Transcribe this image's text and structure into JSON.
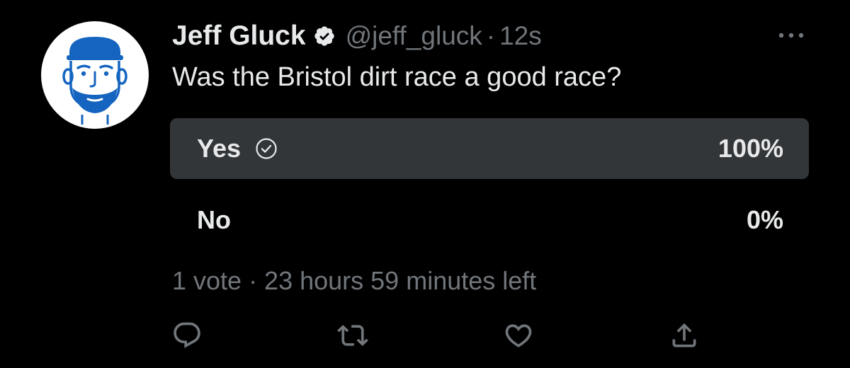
{
  "tweet": {
    "author": {
      "display_name": "Jeff Gluck",
      "handle": "@jeff_gluck",
      "verified": true,
      "avatar_icon": "cartoon-face-with-cap-icon"
    },
    "separator": "·",
    "time": "12s",
    "text": "Was the Bristol dirt race a good race?",
    "more_icon": "ellipsis-icon"
  },
  "poll": {
    "options": [
      {
        "label": "Yes",
        "percent": "100%",
        "fill_fraction": 1.0,
        "selected": true,
        "icon": "check-circle-icon"
      },
      {
        "label": "No",
        "percent": "0%",
        "fill_fraction": 0.0,
        "selected": false
      }
    ],
    "meta": "1 vote · 23 hours 59 minutes left"
  },
  "actions": [
    {
      "name": "reply",
      "icon": "reply-icon"
    },
    {
      "name": "retweet",
      "icon": "retweet-icon"
    },
    {
      "name": "like",
      "icon": "heart-icon"
    },
    {
      "name": "share",
      "icon": "share-icon"
    }
  ],
  "colors": {
    "background": "#000000",
    "primary_text": "#e7e9ea",
    "secondary_text": "#71767b",
    "poll_fill": "#333639",
    "avatar_blue": "#1565c0"
  }
}
